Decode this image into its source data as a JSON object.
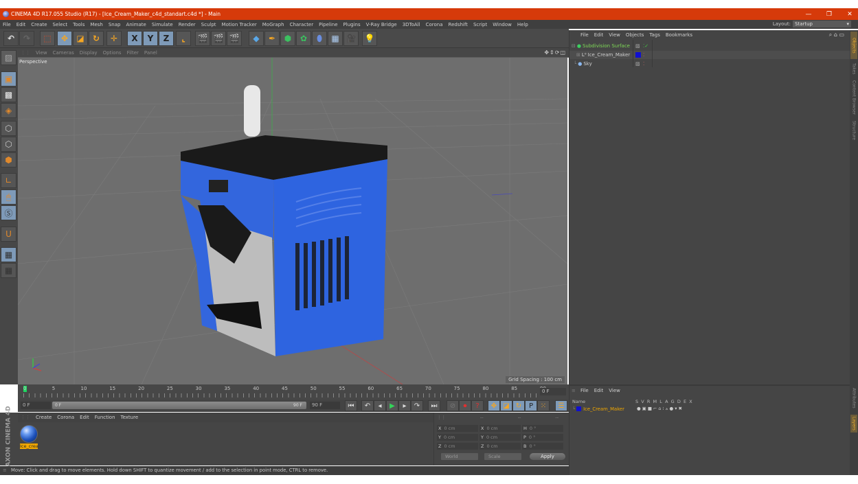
{
  "window": {
    "title": "CINEMA 4D R17.055 Studio (R17) - [Ice_Cream_Maker_c4d_standart.c4d *] - Main",
    "controls": [
      "minimize",
      "restore",
      "close"
    ]
  },
  "menubar": {
    "items": [
      "File",
      "Edit",
      "Create",
      "Select",
      "Tools",
      "Mesh",
      "Snap",
      "Animate",
      "Simulate",
      "Render",
      "Sculpt",
      "Motion Tracker",
      "MoGraph",
      "Character",
      "Pipeline",
      "Plugins",
      "V-Ray Bridge",
      "3DToAll",
      "Corona",
      "Redshift",
      "Script",
      "Window",
      "Help"
    ],
    "layout_label": "Layout:",
    "layout_value": "Startup"
  },
  "toolbar": {
    "icons": [
      "undo-icon",
      "redo-icon",
      "live-selection-icon",
      "move-icon",
      "scale-icon",
      "rotate-icon",
      "last-tool-icon",
      "x-axis-icon",
      "y-axis-icon",
      "z-axis-icon",
      "world-coordinates-icon",
      "render-view-icon",
      "render-picture-viewer-icon",
      "edit-render-settings-icon",
      "cube-icon",
      "pen-icon",
      "subdivision-icon",
      "cloner-icon",
      "deformer-icon",
      "floor-icon",
      "camera-icon",
      "light-icon"
    ],
    "axis_labels": [
      "X",
      "Y",
      "Z"
    ]
  },
  "left_tools": {
    "icons": [
      "make-editable-icon",
      "model-mode-icon",
      "texture-mode-icon",
      "points-mode-icon",
      "edges-mode-icon",
      "polygons-mode-icon",
      "axis-mode-icon",
      "tweak-mode-icon",
      "solo-icon",
      "snap-icon",
      "workplane-lock-icon",
      "workplane-icon"
    ]
  },
  "viewport": {
    "menu": [
      "View",
      "Cameras",
      "Display",
      "Options",
      "Filter",
      "Panel"
    ],
    "label": "Perspective",
    "grid_spacing": "Grid Spacing : 100 cm",
    "nav_icons": [
      "move-view-icon",
      "zoom-view-icon",
      "rotate-view-icon",
      "maximize-view-icon"
    ]
  },
  "timeline": {
    "ticks": [
      "0",
      "5",
      "10",
      "15",
      "20",
      "25",
      "30",
      "35",
      "40",
      "45",
      "50",
      "55",
      "60",
      "65",
      "70",
      "75",
      "80",
      "85",
      "90"
    ],
    "current_frame": "0 F",
    "start_field": "0 F",
    "range_start": "0 F",
    "range_end": "90 F",
    "end_field": "90 F"
  },
  "transport": {
    "buttons": [
      "go-to-start",
      "previous-keyframe",
      "previous-frame",
      "play",
      "next-frame",
      "next-keyframe",
      "go-to-end",
      "record-icon",
      "autokey-icon",
      "keyframe-selection-icon",
      "position-key-icon",
      "scale-key-icon",
      "rotation-key-icon",
      "parameter-key-icon",
      "pla-key-icon",
      "timeline-icon"
    ],
    "param_label": "P"
  },
  "material_manager": {
    "menu": [
      "Create",
      "Corona",
      "Edit",
      "Function",
      "Texture"
    ],
    "materials": [
      {
        "name": "Ice_crea"
      }
    ]
  },
  "brand": {
    "text": "MAXON CINEMA 4D"
  },
  "coordinates": {
    "header": [
      "--",
      "--",
      "--"
    ],
    "rows": [
      {
        "a": "X",
        "av": "0 cm",
        "b": "X",
        "bv": "0 cm",
        "c": "H",
        "cv": "0 °"
      },
      {
        "a": "Y",
        "av": "0 cm",
        "b": "Y",
        "bv": "0 cm",
        "c": "P",
        "cv": "0 °"
      },
      {
        "a": "Z",
        "av": "0 cm",
        "b": "Z",
        "bv": "0 cm",
        "c": "B",
        "cv": "0 °"
      }
    ],
    "mode": "World",
    "transform": "Scale",
    "apply_label": "Apply"
  },
  "status_bar": {
    "text": "Move: Click and drag to move elements. Hold down SHIFT to quantize movement / add to the selection in point mode, CTRL to remove."
  },
  "object_manager": {
    "menu": [
      "File",
      "Edit",
      "View",
      "Objects",
      "Tags",
      "Bookmarks"
    ],
    "objects": [
      {
        "name": "Subdivision Surface",
        "color": "#7ed957",
        "icon": "subdivision-icon"
      },
      {
        "name": "Ice_Cream_Maker",
        "color": "#cfcfcf",
        "icon": "null-object-icon",
        "tag_color": "#1010d0"
      },
      {
        "name": "Sky",
        "color": "#cfcfcf",
        "icon": "sky-icon"
      }
    ]
  },
  "right_tabs_top": [
    "Objects",
    "Takes",
    "Content Browser",
    "Structure"
  ],
  "attributes_manager": {
    "menu": [
      "File",
      "Edit",
      "View"
    ],
    "columns": [
      "Name",
      "S",
      "V",
      "R",
      "M",
      "L",
      "A",
      "G",
      "D",
      "E",
      "X"
    ],
    "rows": [
      {
        "name": "Ice_Cream_Maker",
        "color": "#f0a700",
        "swatch": "#1010d0"
      }
    ]
  },
  "right_tabs_bottom": [
    "Attributes",
    "Layers"
  ],
  "colors": {
    "title_bar": "#d63a0a",
    "accent_blue": "#7e9ab8",
    "selection_orange": "#f0a700",
    "model_blue": "#2e64e0"
  }
}
